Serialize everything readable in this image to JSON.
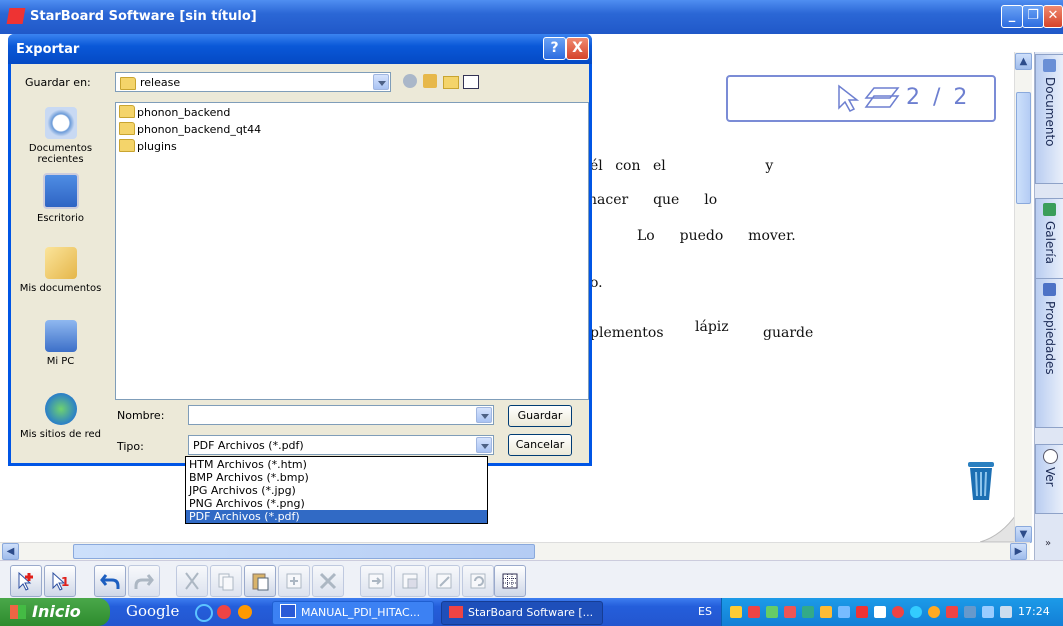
{
  "window": {
    "title": "StarBoard Software [sin título]"
  },
  "canvas": {
    "lines": [
      "él con el        y",
      "hacer  que  lo",
      "Lo  puedo  mover.",
      "o.",
      "plementos",
      "lápiz",
      "guarde"
    ],
    "page_indicator": "2 / 2"
  },
  "sidepanel": {
    "tabs": [
      "Documento",
      "Galería",
      "Propiedades",
      "Ver"
    ]
  },
  "dialog": {
    "title": "Exportar",
    "save_in_label": "Guardar en:",
    "save_in_value": "release",
    "places": [
      "Documentos recientes",
      "Escritorio",
      "Mis documentos",
      "Mi PC",
      "Mis sitios de red"
    ],
    "files": [
      "phonon_backend",
      "phonon_backend_qt44",
      "plugins"
    ],
    "name_label": "Nombre:",
    "name_value": "",
    "type_label": "Tipo:",
    "type_value": "PDF Archivos (*.pdf)",
    "save_button": "Guardar",
    "cancel_button": "Cancelar",
    "type_options": [
      "HTM Archivos (*.htm)",
      "BMP Archivos (*.bmp)",
      "JPG Archivos (*.jpg)",
      "PNG Archivos (*.png)",
      "PDF Archivos (*.pdf)"
    ],
    "help_glyph": "?",
    "close_glyph": "X"
  },
  "taskbar": {
    "start": "Inicio",
    "google": "Google",
    "tasks": [
      "MANUAL_PDI_HITAC...",
      "StarBoard Software [..."
    ],
    "lang": "ES",
    "clock": "17:24"
  },
  "colors": {
    "titlebar": "#2b67d6",
    "selection": "#316ac5",
    "accent": "#6d7fd0"
  }
}
